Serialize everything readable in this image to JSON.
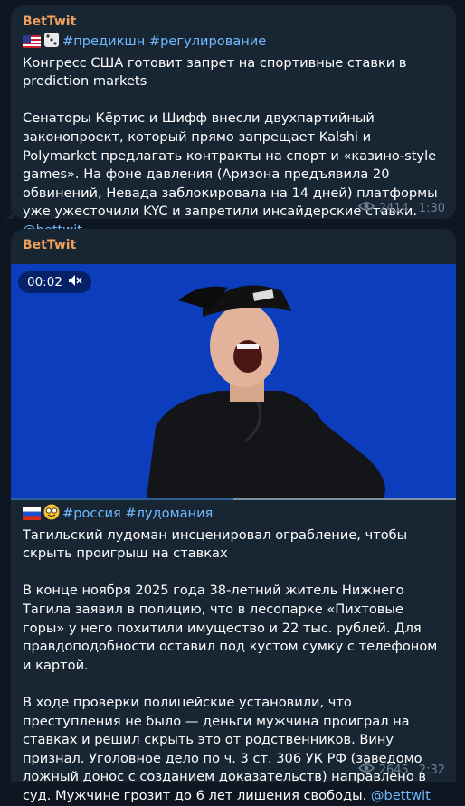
{
  "posts": [
    {
      "author": "BetTwit",
      "tags": "#предикшн #регулирование",
      "headline": "Конгресс США готовит запрет на спортивные ставки в prediction markets",
      "body": "Сенаторы Кёртис и Шифф внесли двухпартийный законопроект, который прямо запрещает Kalshi и Polymarket предлагать контракты на спорт и «казино-style games». На фоне давления (Аризона предъявила 20 обвинений, Невада заблокировала на 14 дней) платформы уже ужесточили KYC и запретили инсайдерские ставки.",
      "mention": "@bettwit",
      "views": "2414",
      "time": "1:30"
    },
    {
      "author": "BetTwit",
      "video": {
        "timer": "00:02",
        "progress": 0.5
      },
      "tags": "#россия #лудомания",
      "headline": "Тагильский лудоман инсценировал ограбление, чтобы скрыть проигрыш на ставках",
      "body1": "В конце ноября 2025 года 38-летний житель Нижнего Тагила заявил в полицию, что в лесопарке «Пихтовые горы» у него похитили имущество и 22 тыс. рублей. Для правдоподобности оставил под кустом сумку с телефоном и картой.",
      "body2": "В ходе проверки полицейские установили, что преступления не было — деньги мужчина проиграл на ставках и решил скрыть это от родственников. Вину признал. Уголовное дело по ч. 3 ст. 306 УК РФ (заведомо ложный донос с созданием доказательств) направлено в суд. Мужчине грозит до 6 лет лишения свободы.",
      "mention": "@bettwit",
      "views": "2645",
      "time": "2:32"
    }
  ]
}
